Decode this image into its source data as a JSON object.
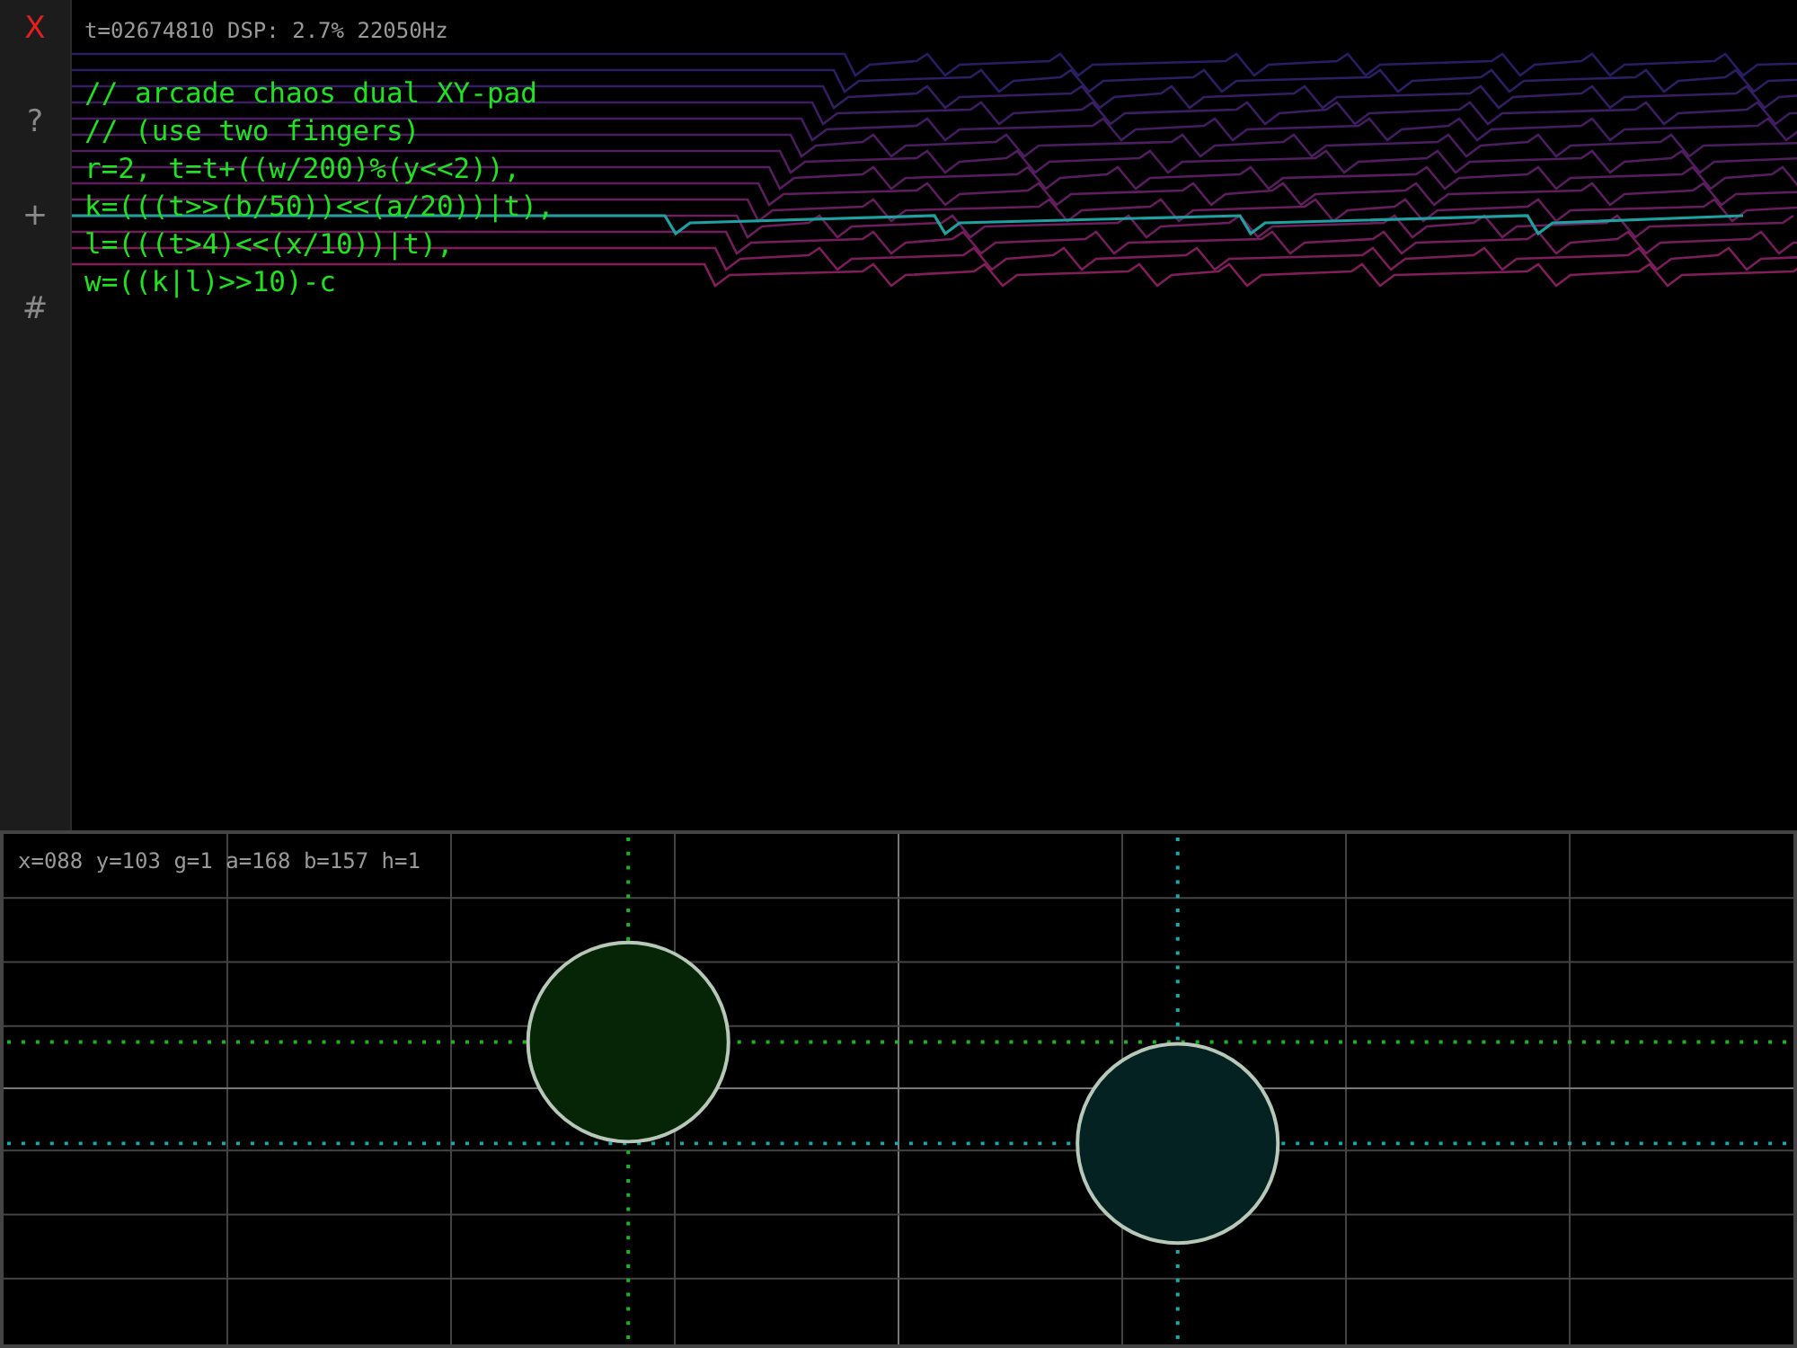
{
  "sidebar": {
    "buttons": [
      {
        "label": "X",
        "kind": "close"
      },
      {
        "label": "?",
        "kind": "help"
      },
      {
        "label": "+",
        "kind": "add"
      },
      {
        "label": "#",
        "kind": "grid"
      }
    ]
  },
  "status": {
    "text": "t=02674810 DSP: 2.7% 22050Hz"
  },
  "code": {
    "lines": [
      "// arcade chaos dual XY-pad",
      "// (use two fingers)",
      "r=2, t=t+((w/200)%(y<<2)),",
      "k=(((t>>(b/50))<<(a/20))|t),",
      "l=(((t>4)<<(x/10))|t),",
      "w=((k|l)>>10)-c"
    ]
  },
  "xy_pad": {
    "readout": "x=088 y=103 g=1 a=168 b=157 h=1",
    "touches": [
      {
        "color": "#062406"
      },
      {
        "color": "#052222"
      }
    ]
  }
}
